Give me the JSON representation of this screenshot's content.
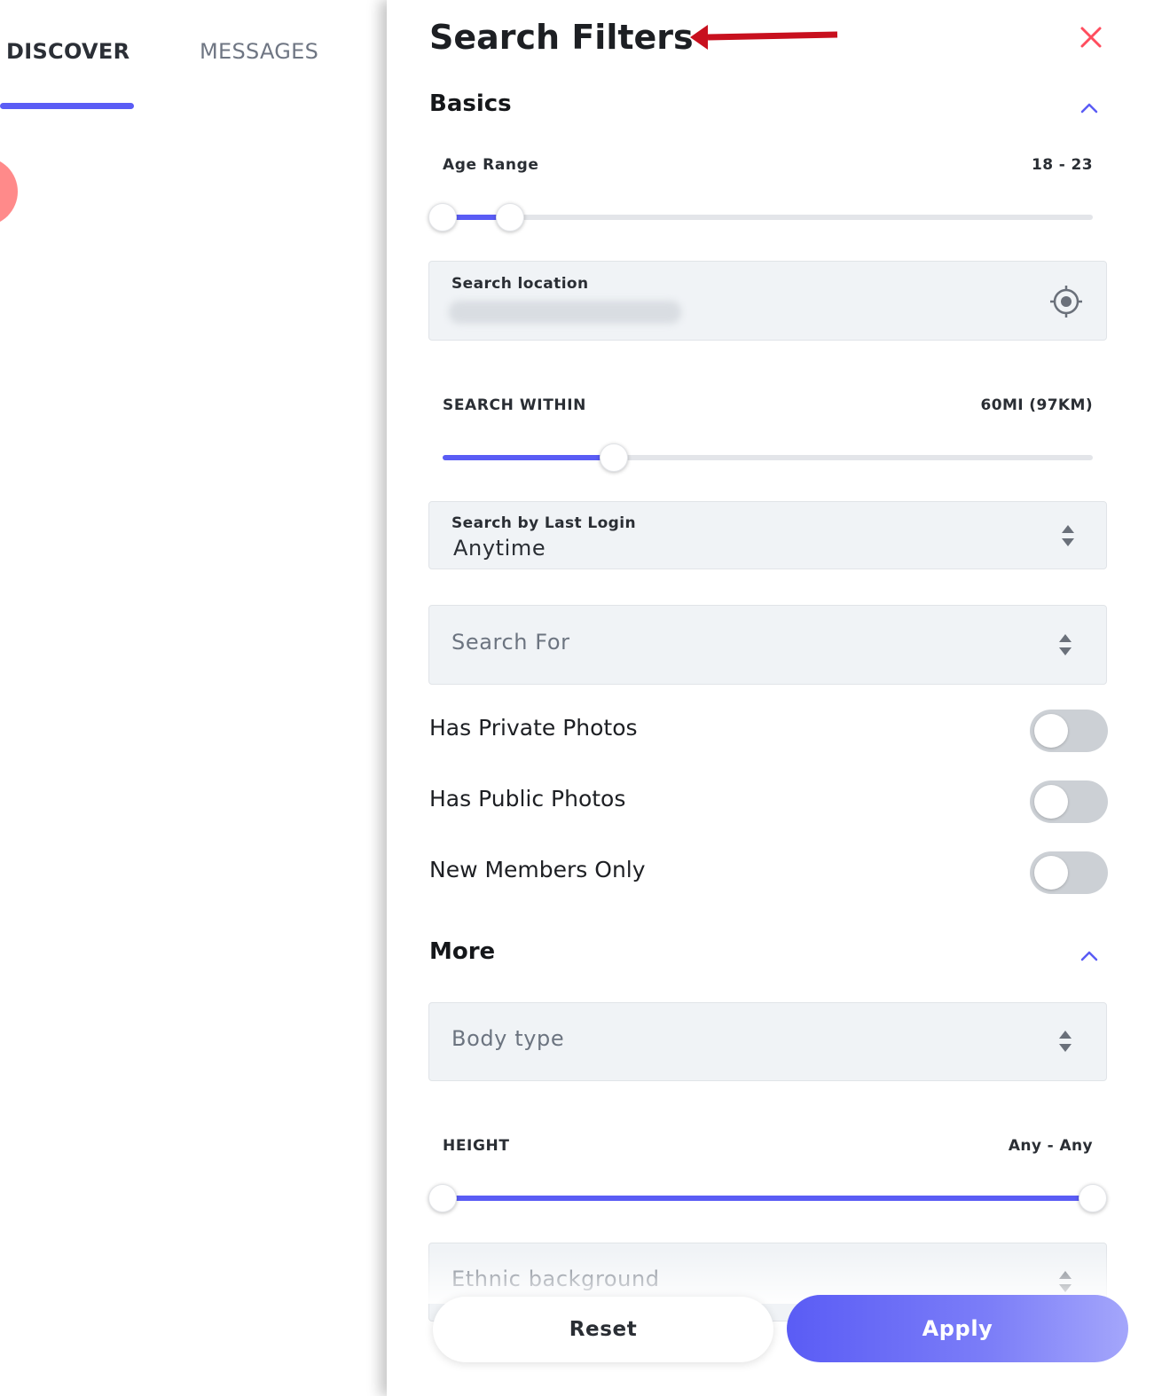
{
  "tabs": {
    "discover": "DISCOVER",
    "messages": "MESSAGES"
  },
  "drawer": {
    "title": "Search Filters",
    "close_icon": "close-icon",
    "accent_color": "#5a5cf5",
    "close_color": "#ff4d5e"
  },
  "basics": {
    "title": "Basics",
    "age_range": {
      "label": "Age Range",
      "value": "18 - 23",
      "min_fraction": 0.0,
      "max_fraction": 0.1
    },
    "search_location": {
      "label": "Search location",
      "value_blurred": true,
      "icon": "locate-icon"
    },
    "search_within": {
      "label": "SEARCH WITHIN",
      "value": "60MI (97KM)",
      "fraction": 0.26
    },
    "last_login": {
      "label": "Search by Last Login",
      "value": "Anytime"
    },
    "search_for": {
      "placeholder": "Search For"
    },
    "toggles": [
      {
        "label": "Has Private Photos",
        "on": false
      },
      {
        "label": "Has Public Photos",
        "on": false
      },
      {
        "label": "New Members Only",
        "on": false
      }
    ]
  },
  "more": {
    "title": "More",
    "body_type": {
      "placeholder": "Body type"
    },
    "height": {
      "label": "HEIGHT",
      "value": "Any - Any",
      "min_fraction": 0.0,
      "max_fraction": 1.0
    },
    "ethnic": {
      "placeholder": "Ethnic background"
    }
  },
  "buttons": {
    "reset": "Reset",
    "apply": "Apply"
  }
}
